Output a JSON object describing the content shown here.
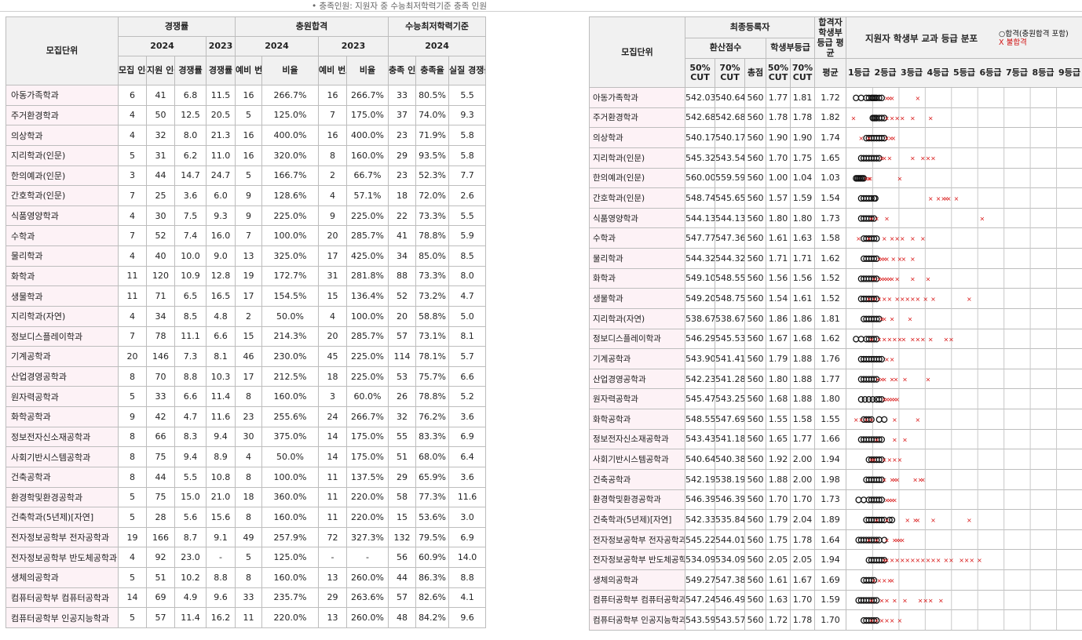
{
  "note": "• 충족인원: 지원자 중 수능최저학력기준 충족 인원",
  "left": {
    "headers": {
      "unit": "모집단위",
      "competition": "경쟁률",
      "additional": "충원합격",
      "minstd": "수능최저학력기준",
      "y2024": "2024",
      "y2023": "2023",
      "recruit": "모집 인원",
      "applicants": "지원 인원",
      "ratio": "경쟁률",
      "ratio2023": "경쟁률",
      "waitno": "예비 번호",
      "rate": "비율",
      "waitno23": "예비 번호",
      "rate23": "비율",
      "satisfied": "충족 인원",
      "satrate": "충족율",
      "realratio": "실질 경쟁률"
    },
    "rows": [
      [
        "아동가족학과",
        "6",
        "41",
        "6.8",
        "11.5",
        "16",
        "266.7%",
        "16",
        "266.7%",
        "33",
        "80.5%",
        "5.5"
      ],
      [
        "주거환경학과",
        "4",
        "50",
        "12.5",
        "20.5",
        "5",
        "125.0%",
        "7",
        "175.0%",
        "37",
        "74.0%",
        "9.3"
      ],
      [
        "의상학과",
        "4",
        "32",
        "8.0",
        "21.3",
        "16",
        "400.0%",
        "16",
        "400.0%",
        "23",
        "71.9%",
        "5.8"
      ],
      [
        "지리학과(인문)",
        "5",
        "31",
        "6.2",
        "11.0",
        "16",
        "320.0%",
        "8",
        "160.0%",
        "29",
        "93.5%",
        "5.8"
      ],
      [
        "한의예과(인문)",
        "3",
        "44",
        "14.7",
        "24.7",
        "5",
        "166.7%",
        "2",
        "66.7%",
        "23",
        "52.3%",
        "7.7"
      ],
      [
        "간호학과(인문)",
        "7",
        "25",
        "3.6",
        "6.0",
        "9",
        "128.6%",
        "4",
        "57.1%",
        "18",
        "72.0%",
        "2.6"
      ],
      [
        "식품영양학과",
        "4",
        "30",
        "7.5",
        "9.3",
        "9",
        "225.0%",
        "9",
        "225.0%",
        "22",
        "73.3%",
        "5.5"
      ],
      [
        "수학과",
        "7",
        "52",
        "7.4",
        "16.0",
        "7",
        "100.0%",
        "20",
        "285.7%",
        "41",
        "78.8%",
        "5.9"
      ],
      [
        "물리학과",
        "4",
        "40",
        "10.0",
        "9.0",
        "13",
        "325.0%",
        "17",
        "425.0%",
        "34",
        "85.0%",
        "8.5"
      ],
      [
        "화학과",
        "11",
        "120",
        "10.9",
        "12.8",
        "19",
        "172.7%",
        "31",
        "281.8%",
        "88",
        "73.3%",
        "8.0"
      ],
      [
        "생물학과",
        "11",
        "71",
        "6.5",
        "16.5",
        "17",
        "154.5%",
        "15",
        "136.4%",
        "52",
        "73.2%",
        "4.7"
      ],
      [
        "지리학과(자연)",
        "4",
        "34",
        "8.5",
        "4.8",
        "2",
        "50.0%",
        "4",
        "100.0%",
        "20",
        "58.8%",
        "5.0"
      ],
      [
        "정보디스플레이학과",
        "7",
        "78",
        "11.1",
        "6.6",
        "15",
        "214.3%",
        "20",
        "285.7%",
        "57",
        "73.1%",
        "8.1"
      ],
      [
        "기계공학과",
        "20",
        "146",
        "7.3",
        "8.1",
        "46",
        "230.0%",
        "45",
        "225.0%",
        "114",
        "78.1%",
        "5.7"
      ],
      [
        "산업경영공학과",
        "8",
        "70",
        "8.8",
        "10.3",
        "17",
        "212.5%",
        "18",
        "225.0%",
        "53",
        "75.7%",
        "6.6"
      ],
      [
        "원자력공학과",
        "5",
        "33",
        "6.6",
        "11.4",
        "8",
        "160.0%",
        "3",
        "60.0%",
        "26",
        "78.8%",
        "5.2"
      ],
      [
        "화학공학과",
        "9",
        "42",
        "4.7",
        "11.6",
        "23",
        "255.6%",
        "24",
        "266.7%",
        "32",
        "76.2%",
        "3.6"
      ],
      [
        "정보전자신소재공학과",
        "8",
        "66",
        "8.3",
        "9.4",
        "30",
        "375.0%",
        "14",
        "175.0%",
        "55",
        "83.3%",
        "6.9"
      ],
      [
        "사회기반시스템공학과",
        "8",
        "75",
        "9.4",
        "8.9",
        "4",
        "50.0%",
        "14",
        "175.0%",
        "51",
        "68.0%",
        "6.4"
      ],
      [
        "건축공학과",
        "8",
        "44",
        "5.5",
        "10.8",
        "8",
        "100.0%",
        "11",
        "137.5%",
        "29",
        "65.9%",
        "3.6"
      ],
      [
        "환경학및환경공학과",
        "5",
        "75",
        "15.0",
        "21.0",
        "18",
        "360.0%",
        "11",
        "220.0%",
        "58",
        "77.3%",
        "11.6"
      ],
      [
        "건축학과(5년제)[자연]",
        "5",
        "28",
        "5.6",
        "15.6",
        "8",
        "160.0%",
        "11",
        "220.0%",
        "15",
        "53.6%",
        "3.0"
      ],
      [
        "전자정보공학부 전자공학과",
        "19",
        "166",
        "8.7",
        "9.1",
        "49",
        "257.9%",
        "72",
        "327.3%",
        "132",
        "79.5%",
        "6.9"
      ],
      [
        "전자정보공학부 반도체공학과",
        "4",
        "92",
        "23.0",
        "-",
        "5",
        "125.0%",
        "-",
        "-",
        "56",
        "60.9%",
        "14.0"
      ],
      [
        "생체의공학과",
        "5",
        "51",
        "10.2",
        "8.8",
        "8",
        "160.0%",
        "13",
        "260.0%",
        "44",
        "86.3%",
        "8.8"
      ],
      [
        "컴퓨터공학부 컴퓨터공학과",
        "14",
        "69",
        "4.9",
        "9.6",
        "33",
        "235.7%",
        "29",
        "263.6%",
        "57",
        "82.6%",
        "4.1"
      ],
      [
        "컴퓨터공학부 인공지능학과",
        "5",
        "57",
        "11.4",
        "16.2",
        "11",
        "220.0%",
        "13",
        "260.0%",
        "48",
        "84.2%",
        "9.6"
      ]
    ]
  },
  "right": {
    "headers": {
      "unit": "모집단위",
      "final": "최종등록자",
      "passer": "합격자 학생부 등급 평균",
      "dist": "지원자 학생부 교과 등급 분포",
      "legend_pass": "○합격(충원합격 포함)",
      "legend_fail": "X 불합격",
      "conv": "환산점수",
      "record": "학생부등급",
      "c50": "50% CUT",
      "c70": "70% CUT",
      "total": "총점",
      "g50": "50% CUT",
      "g70": "70% CUT",
      "avg": "평균",
      "grades": [
        "1등급",
        "2등급",
        "3등급",
        "4등급",
        "5등급",
        "6등급",
        "7등급",
        "8등급",
        "9등급"
      ]
    },
    "rows": [
      [
        "아동가족학과",
        "542.03",
        "540.64",
        "560",
        "1.77",
        "1.81",
        "1.72"
      ],
      [
        "주거환경학과",
        "542.68",
        "542.68",
        "560",
        "1.78",
        "1.78",
        "1.82"
      ],
      [
        "의상학과",
        "540.17",
        "540.17",
        "560",
        "1.90",
        "1.90",
        "1.74"
      ],
      [
        "지리학과(인문)",
        "545.32",
        "543.54",
        "560",
        "1.70",
        "1.75",
        "1.65"
      ],
      [
        "한의예과(인문)",
        "560.00",
        "559.59",
        "560",
        "1.00",
        "1.04",
        "1.03"
      ],
      [
        "간호학과(인문)",
        "548.74",
        "545.65",
        "560",
        "1.57",
        "1.59",
        "1.54"
      ],
      [
        "식품영양학과",
        "544.13",
        "544.13",
        "560",
        "1.80",
        "1.80",
        "1.73"
      ],
      [
        "수학과",
        "547.77",
        "547.36",
        "560",
        "1.61",
        "1.63",
        "1.58"
      ],
      [
        "물리학과",
        "544.32",
        "544.32",
        "560",
        "1.71",
        "1.71",
        "1.62"
      ],
      [
        "화학과",
        "549.10",
        "548.55",
        "560",
        "1.56",
        "1.56",
        "1.52"
      ],
      [
        "생물학과",
        "549.20",
        "548.75",
        "560",
        "1.54",
        "1.61",
        "1.52"
      ],
      [
        "지리학과(자연)",
        "538.67",
        "538.67",
        "560",
        "1.86",
        "1.86",
        "1.81"
      ],
      [
        "정보디스플레이학과",
        "546.29",
        "545.53",
        "560",
        "1.67",
        "1.68",
        "1.62"
      ],
      [
        "기계공학과",
        "543.90",
        "541.41",
        "560",
        "1.79",
        "1.88",
        "1.76"
      ],
      [
        "산업경영공학과",
        "542.23",
        "541.28",
        "560",
        "1.80",
        "1.88",
        "1.77"
      ],
      [
        "원자력공학과",
        "545.47",
        "543.25",
        "560",
        "1.68",
        "1.88",
        "1.80"
      ],
      [
        "화학공학과",
        "548.55",
        "547.69",
        "560",
        "1.55",
        "1.58",
        "1.55"
      ],
      [
        "정보전자신소재공학과",
        "543.43",
        "541.18",
        "560",
        "1.65",
        "1.77",
        "1.66"
      ],
      [
        "사회기반시스템공학과",
        "540.64",
        "540.38",
        "560",
        "1.92",
        "2.00",
        "1.94"
      ],
      [
        "건축공학과",
        "542.19",
        "538.19",
        "560",
        "1.88",
        "2.00",
        "1.98"
      ],
      [
        "환경학및환경공학과",
        "546.39",
        "546.39",
        "560",
        "1.70",
        "1.70",
        "1.73"
      ],
      [
        "건축학과(5년제)[자연]",
        "542.33",
        "535.84",
        "560",
        "1.79",
        "2.04",
        "1.89"
      ],
      [
        "전자정보공학부 전자공학과",
        "545.22",
        "544.01",
        "560",
        "1.75",
        "1.78",
        "1.64"
      ],
      [
        "전자정보공학부 반도체공학과",
        "534.09",
        "534.09",
        "560",
        "2.05",
        "2.05",
        "1.94"
      ],
      [
        "생체의공학과",
        "549.27",
        "547.38",
        "560",
        "1.61",
        "1.67",
        "1.69"
      ],
      [
        "컴퓨터공학부 컴퓨터공학과",
        "547.24",
        "546.49",
        "560",
        "1.63",
        "1.70",
        "1.59"
      ],
      [
        "컴퓨터공학부 인공지능학과",
        "543.59",
        "543.57",
        "560",
        "1.72",
        "1.78",
        "1.70"
      ]
    ],
    "distribution": [
      {
        "pass": [
          1.1,
          1.3,
          1.5,
          1.6,
          1.7,
          1.75,
          1.8,
          1.85,
          1.9,
          2.0,
          2.1
        ],
        "fail": [
          2.3,
          2.4,
          2.5,
          3.5
        ]
      },
      {
        "pass": [
          1.75,
          1.8,
          1.85,
          1.9,
          2.0,
          2.1,
          2.2
        ],
        "fail": [
          1.0,
          2.3,
          2.5,
          2.7,
          2.9,
          3.3,
          4.0
        ]
      },
      {
        "pass": [
          1.5,
          1.6,
          1.7,
          1.8,
          1.9,
          2.0,
          2.1,
          2.2
        ],
        "fail": [
          1.3,
          1.6,
          2.3,
          2.45,
          2.55
        ]
      },
      {
        "pass": [
          1.3,
          1.4,
          1.5,
          1.6,
          1.7,
          1.8,
          1.9,
          2.0
        ],
        "fail": [
          2.1,
          2.2,
          2.4,
          3.3,
          3.7,
          3.9,
          4.1
        ]
      },
      {
        "pass": [
          1.1,
          1.15,
          1.2,
          1.25,
          1.3,
          1.35,
          1.4
        ],
        "fail": [
          1.5,
          1.6,
          1.65,
          2.8
        ]
      },
      {
        "pass": [
          1.3,
          1.4,
          1.5,
          1.6,
          1.7,
          1.8,
          1.85
        ],
        "fail": [
          4.0,
          4.3,
          4.5,
          4.6,
          4.7,
          5.0
        ]
      },
      {
        "pass": [
          1.3,
          1.4,
          1.5,
          1.6,
          1.7,
          1.8
        ],
        "fail": [
          1.7,
          1.9,
          2.3,
          6.0
        ]
      },
      {
        "pass": [
          1.4,
          1.5,
          1.6,
          1.7,
          1.8,
          1.9
        ],
        "fail": [
          1.2,
          1.6,
          2.2,
          2.5,
          2.7,
          2.9,
          3.3,
          3.7
        ]
      },
      {
        "pass": [
          1.4,
          1.5,
          1.6,
          1.7,
          1.8,
          1.9
        ],
        "fail": [
          2.0,
          2.1,
          2.2,
          2.3,
          2.55,
          2.8,
          2.95,
          3.3
        ]
      },
      {
        "pass": [
          1.3,
          1.4,
          1.5,
          1.6,
          1.7,
          1.8,
          1.9
        ],
        "fail": [
          1.8,
          2.0,
          2.1,
          2.2,
          2.3,
          2.4,
          2.5,
          2.7,
          3.3,
          3.9
        ]
      },
      {
        "pass": [
          1.3,
          1.4,
          1.5,
          1.6,
          1.7,
          1.8,
          1.9
        ],
        "fail": [
          1.6,
          1.8,
          2.0,
          2.2,
          2.4,
          2.7,
          2.9,
          3.1,
          3.3,
          3.5,
          3.8,
          4.1,
          5.5
        ]
      },
      {
        "pass": [
          1.4,
          1.5,
          1.6,
          1.7,
          1.8,
          1.9,
          2.0
        ],
        "fail": [
          2.1,
          2.2,
          2.5,
          3.2
        ]
      },
      {
        "pass": [
          1.1,
          1.3,
          1.5,
          1.6,
          1.7,
          1.8,
          1.9
        ],
        "fail": [
          1.7,
          2.0,
          2.2,
          2.4,
          2.6,
          2.8,
          2.95,
          3.3,
          3.5,
          3.7,
          4.0,
          4.6,
          4.8
        ]
      },
      {
        "pass": [
          1.3,
          1.4,
          1.5,
          1.6,
          1.7,
          1.8,
          1.9,
          2.0,
          2.1
        ],
        "fail": [
          2.3,
          2.5
        ]
      },
      {
        "pass": [
          1.3,
          1.4,
          1.5,
          1.6,
          1.7,
          1.8,
          1.9
        ],
        "fail": [
          1.95,
          2.1,
          2.2,
          2.5,
          2.65,
          3.0,
          3.9
        ]
      },
      {
        "pass": [
          1.3,
          1.45,
          1.6,
          1.75,
          1.9,
          2.0,
          2.1
        ],
        "fail": [
          2.2,
          2.3,
          2.4,
          2.5,
          2.6,
          2.7
        ]
      },
      {
        "pass": [
          1.4,
          1.5,
          1.6,
          1.7,
          2.0,
          2.2
        ],
        "fail": [
          1.1,
          1.3,
          1.5,
          1.7,
          2.6,
          3.5
        ]
      },
      {
        "pass": [
          1.3,
          1.4,
          1.5,
          1.6,
          1.7,
          1.8,
          1.9,
          2.0,
          2.1
        ],
        "fail": [
          1.9,
          2.6,
          3.0
        ]
      },
      {
        "pass": [
          1.6,
          1.7,
          1.8,
          1.9,
          2.0,
          2.1
        ],
        "fail": [
          1.7,
          1.8,
          2.2,
          2.4,
          2.6,
          2.8
        ]
      },
      {
        "pass": [
          1.5,
          1.6,
          1.7,
          1.8,
          1.9,
          2.0,
          2.1
        ],
        "fail": [
          2.2,
          2.5,
          2.6,
          2.7,
          3.4,
          3.6,
          3.7
        ]
      },
      {
        "pass": [
          1.2,
          1.4,
          1.6,
          1.7,
          1.8,
          1.9,
          2.0,
          2.1
        ],
        "fail": [
          2.3,
          2.4,
          2.5,
          2.6
        ]
      },
      {
        "pass": [
          1.5,
          1.6,
          1.7,
          1.8,
          1.9,
          2.0,
          2.1,
          2.2,
          2.4,
          2.5
        ],
        "fail": [
          1.9,
          2.3,
          3.1,
          3.4,
          3.5,
          4.1,
          5.5
        ]
      },
      {
        "pass": [
          1.2,
          1.3,
          1.4,
          1.5,
          1.6,
          1.7,
          1.8,
          1.9,
          2.0,
          2.2
        ],
        "fail": [
          1.6,
          1.9,
          2.3,
          2.6,
          2.7,
          2.8,
          2.9
        ]
      },
      {
        "pass": [
          1.6,
          1.7,
          1.8,
          1.9,
          2.0,
          2.1,
          2.2
        ],
        "fail": [
          2.2,
          2.3,
          2.5,
          2.7,
          2.9,
          3.1,
          3.3,
          3.5,
          3.7,
          3.9,
          4.1,
          4.3,
          4.6,
          4.8,
          5.2,
          5.4,
          5.6,
          5.9
        ]
      },
      {
        "pass": [
          1.4,
          1.5,
          1.6,
          1.7,
          1.8
        ],
        "fail": [
          1.8,
          2.0,
          2.2,
          2.4,
          2.5
        ]
      },
      {
        "pass": [
          1.2,
          1.3,
          1.4,
          1.5,
          1.6,
          1.7,
          1.8,
          1.9
        ],
        "fail": [
          1.7,
          2.1,
          2.3,
          2.6,
          3.0,
          3.6,
          3.8,
          4.0,
          4.4
        ]
      },
      {
        "pass": [
          1.4,
          1.5,
          1.6,
          1.7,
          1.8,
          1.9
        ],
        "fail": [
          1.7,
          1.9,
          2.1,
          2.3,
          2.5,
          2.8
        ]
      }
    ]
  },
  "colors": {
    "fail": "#d81414",
    "pass": "#111111",
    "name_bg": "#fdf2f6",
    "header_bg": "#f1f1f1"
  }
}
